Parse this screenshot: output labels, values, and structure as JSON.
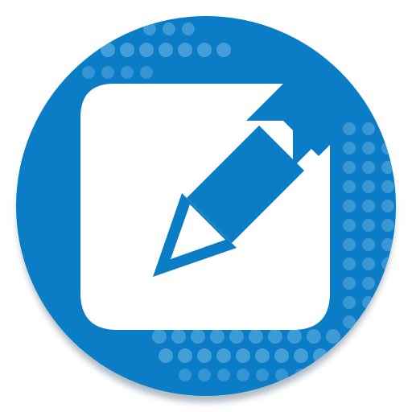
{
  "icon": {
    "name": "notes-edit-app-icon",
    "depicts": "pencil-over-note-icon",
    "colors": {
      "background_circle": "#0a7dc6",
      "dots": "#6ab4e4",
      "note_card": "#ffffff",
      "pencil": "#0a7dc6",
      "shadow": "#1b3a52"
    }
  }
}
